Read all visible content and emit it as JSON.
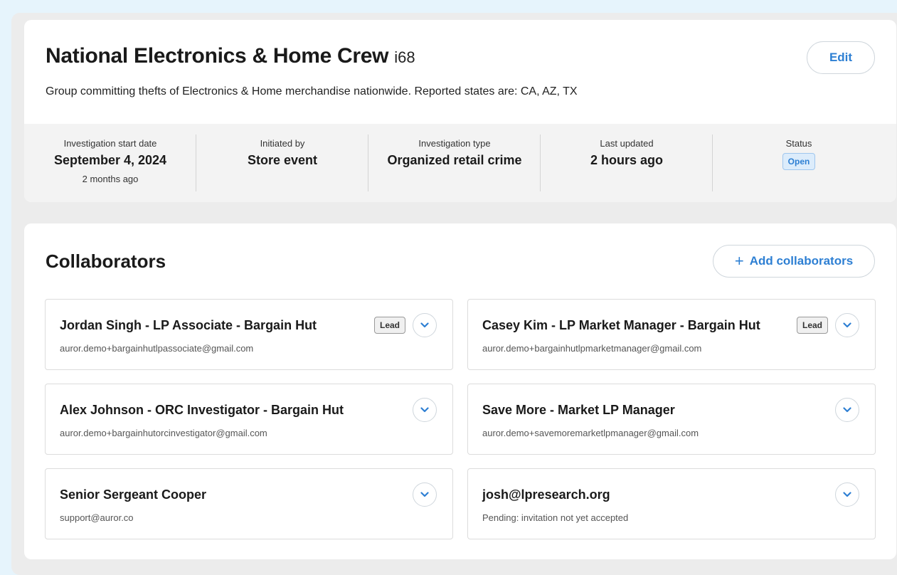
{
  "group": {
    "name": "National Electronics & Home Crew",
    "id": "i68",
    "description": "Group committing thefts of Electronics & Home merchandise nationwide. Reported states are: CA, AZ, TX",
    "edit_label": "Edit"
  },
  "stats": [
    {
      "label": "Investigation start date",
      "value": "September 4, 2024",
      "sub": "2 months ago"
    },
    {
      "label": "Initiated by",
      "value": "Store event"
    },
    {
      "label": "Investigation type",
      "value": "Organized retail crime"
    },
    {
      "label": "Last updated",
      "value": "2 hours ago"
    },
    {
      "label": "Status",
      "badge": "Open"
    }
  ],
  "collaborators_section": {
    "title": "Collaborators",
    "add_label": "Add collaborators",
    "lead_badge": "Lead"
  },
  "collaborators": [
    {
      "name": "Jordan Singh - LP Associate - Bargain Hut",
      "email": "auror.demo+bargainhutlpassociate@gmail.com",
      "lead": true
    },
    {
      "name": "Casey Kim - LP Market Manager - Bargain Hut",
      "email": "auror.demo+bargainhutlpmarketmanager@gmail.com",
      "lead": true
    },
    {
      "name": "Alex Johnson - ORC Investigator - Bargain Hut",
      "email": "auror.demo+bargainhutorcinvestigator@gmail.com",
      "lead": false
    },
    {
      "name": "Save More - Market LP Manager",
      "email": "auror.demo+savemoremarketlpmanager@gmail.com",
      "lead": false
    },
    {
      "name": "Senior Sergeant Cooper",
      "email": "support@auror.co",
      "lead": false
    },
    {
      "name": "josh@lpresearch.org",
      "email": "Pending: invitation not yet accepted",
      "lead": false
    }
  ],
  "icons": {
    "expand": "chevron-down-icon",
    "add": "plus-icon"
  },
  "colors": {
    "accent": "#2d7fd3",
    "page_background": "#e6f4fc",
    "status_open_bg": "#dcecfb"
  }
}
